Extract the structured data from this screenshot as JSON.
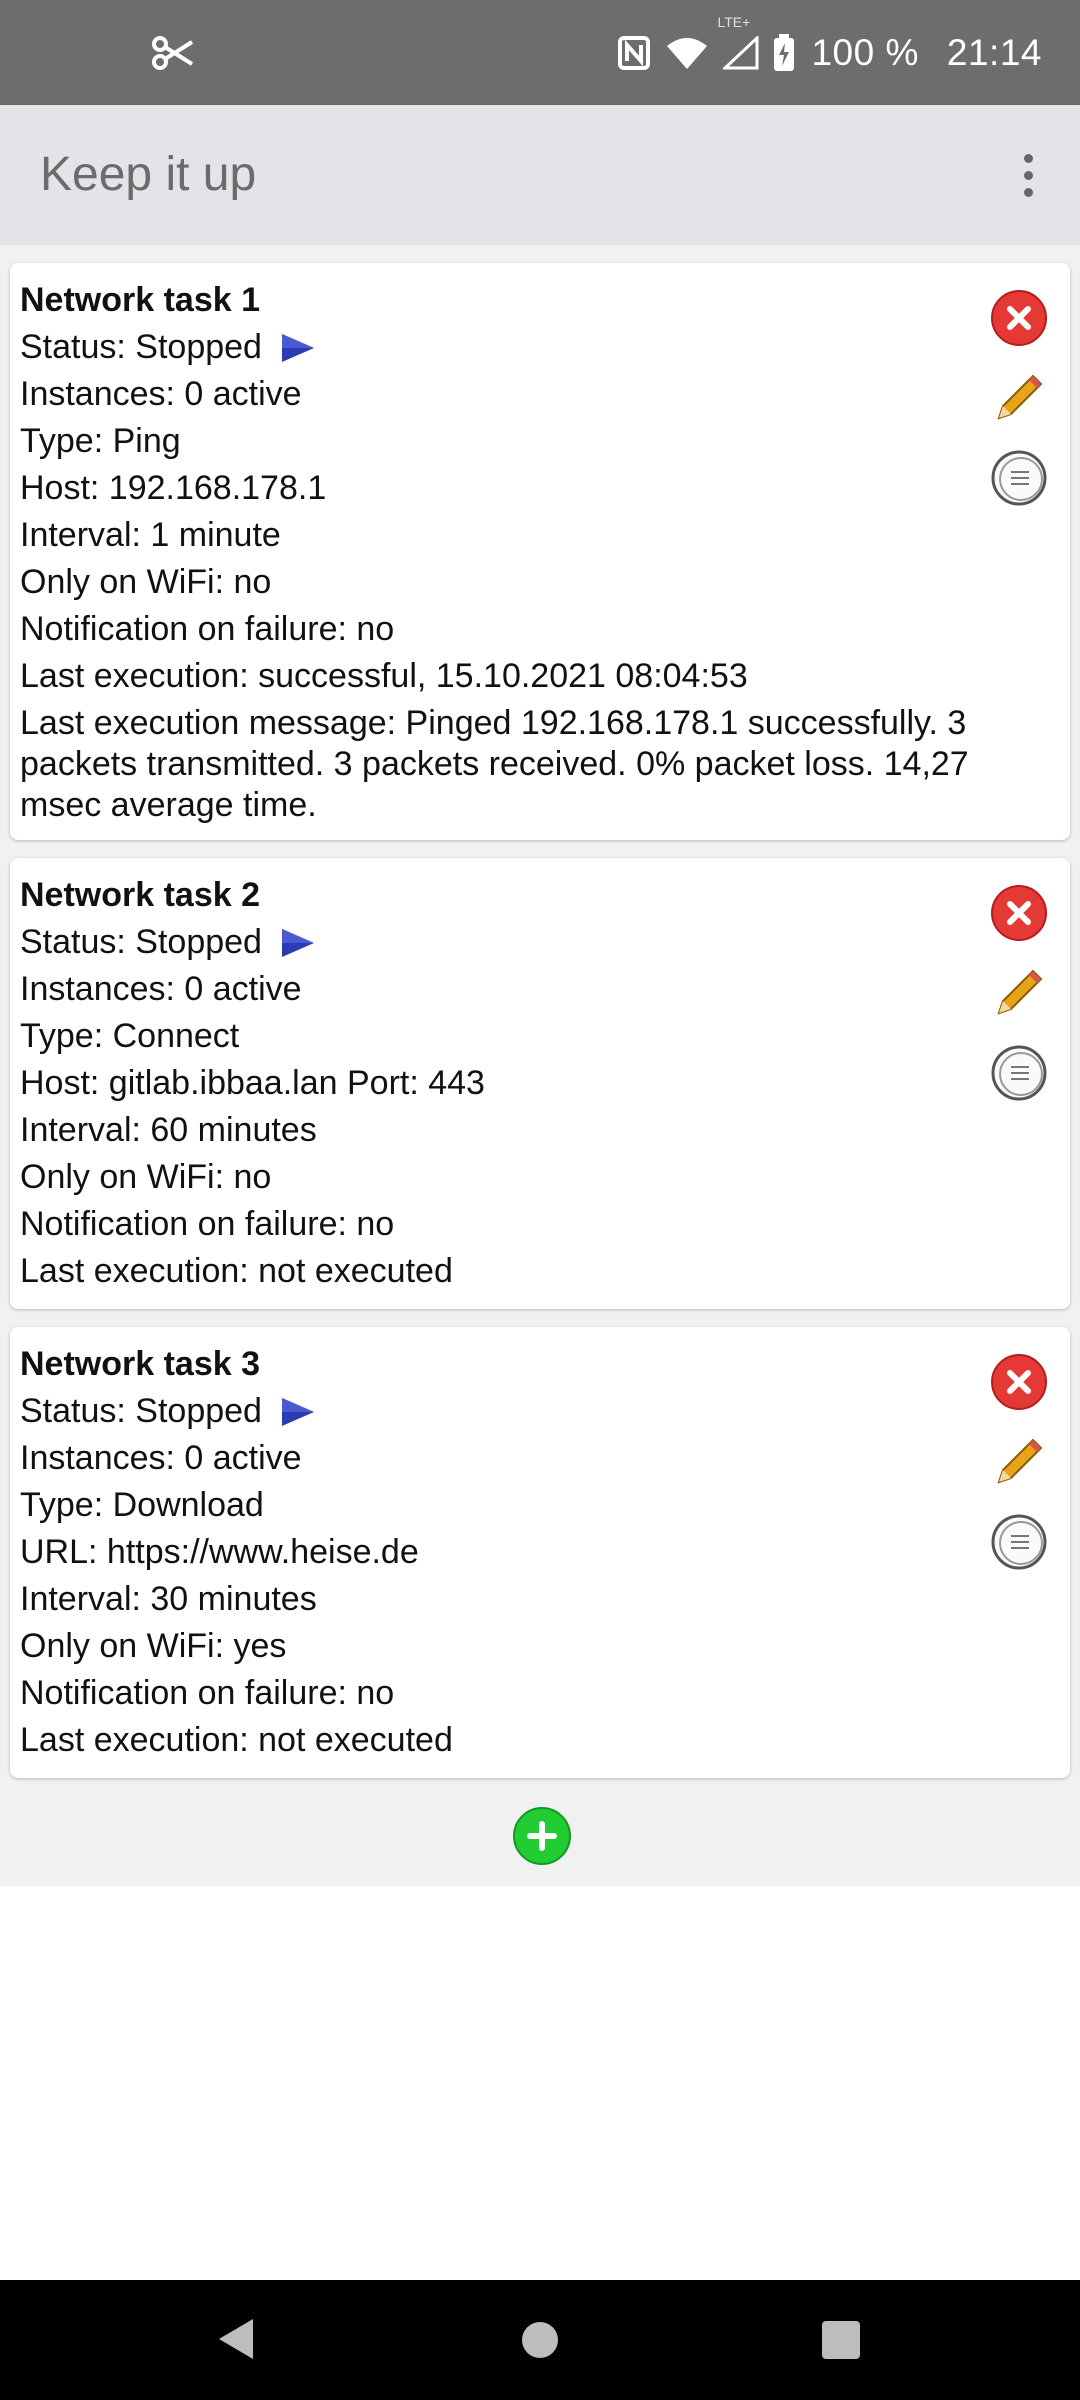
{
  "status_bar": {
    "battery_text": "100 %",
    "time": "21:14",
    "network_label": "LTE+"
  },
  "app_bar": {
    "title": "Keep it up"
  },
  "tasks": [
    {
      "title": "Network task 1",
      "status": "Status: Stopped",
      "instances": "Instances: 0 active",
      "type": "Type: Ping",
      "target": "Host: 192.168.178.1",
      "interval": "Interval: 1 minute",
      "wifi": "Only on WiFi: no",
      "notification": "Notification on failure: no",
      "last_execution": "Last execution: successful, 15.10.2021 08:04:53",
      "last_message": "Last execution message: Pinged 192.168.178.1 successfully. 3 packets transmitted. 3 packets received. 0% packet loss. 14,27 msec average time."
    },
    {
      "title": "Network task 2",
      "status": "Status: Stopped",
      "instances": "Instances: 0 active",
      "type": "Type: Connect",
      "target": "Host: gitlab.ibbaa.lan Port: 443",
      "interval": "Interval: 60 minutes",
      "wifi": "Only on WiFi: no",
      "notification": "Notification on failure: no",
      "last_execution": "Last execution: not executed"
    },
    {
      "title": "Network task 3",
      "status": "Status: Stopped",
      "instances": "Instances: 0 active",
      "type": "Type: Download",
      "target": "URL: https://www.heise.de",
      "interval": "Interval: 30 minutes",
      "wifi": "Only on WiFi: yes",
      "notification": "Notification on failure: no",
      "last_execution": "Last execution: not executed"
    }
  ],
  "colors": {
    "status_bar_bg": "#6d6d6d",
    "app_bar_bg": "#e3e3e8",
    "play_icon": "#2b3bb0",
    "delete_icon": "#e53935",
    "add_icon": "#22cc33"
  },
  "icons": {
    "status_left": "scissors-icon",
    "play": "play-icon",
    "delete": "delete-icon",
    "edit": "pencil-icon",
    "log": "log-icon",
    "add": "add-icon"
  }
}
